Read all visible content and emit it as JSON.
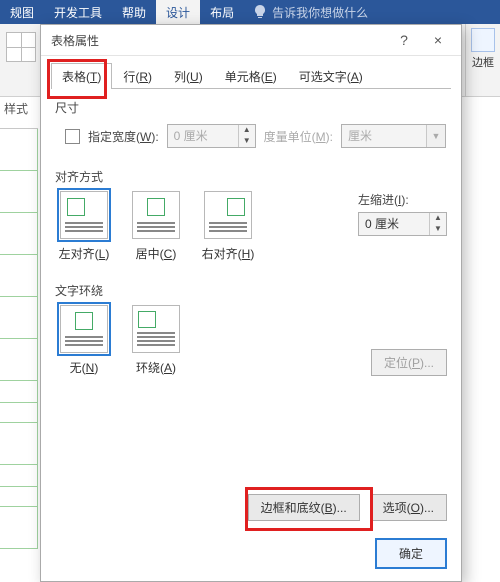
{
  "ribbon": {
    "tabs": [
      "规图",
      "开发工具",
      "帮助",
      "设计",
      "布局"
    ],
    "search_placeholder": "告诉我你想做什么"
  },
  "sidebar": {
    "styles_label": "样式",
    "border_label": "边框"
  },
  "dialog": {
    "title": "表格属性",
    "help_icon": "?",
    "close_icon": "×",
    "tabs": {
      "table": "表格(T)",
      "row": "行(R)",
      "column": "列(U)",
      "cell": "单元格(E)",
      "alt": "可选文字(A)"
    },
    "size": {
      "legend": "尺寸",
      "specify_width_label": "指定宽度(W):",
      "width_value": "0 厘米",
      "unit_label": "度量单位(M):",
      "unit_value": "厘米"
    },
    "align": {
      "legend": "对齐方式",
      "left": "左对齐(L)",
      "center": "居中(C)",
      "right": "右对齐(H)",
      "indent_label": "左缩进(I):",
      "indent_value": "0 厘米"
    },
    "wrap": {
      "legend": "文字环绕",
      "none": "无(N)",
      "around": "环绕(A)",
      "position_btn": "定位(P)..."
    },
    "buttons": {
      "borders": "边框和底纹(B)...",
      "options": "选项(O)...",
      "ok": "确定"
    }
  }
}
